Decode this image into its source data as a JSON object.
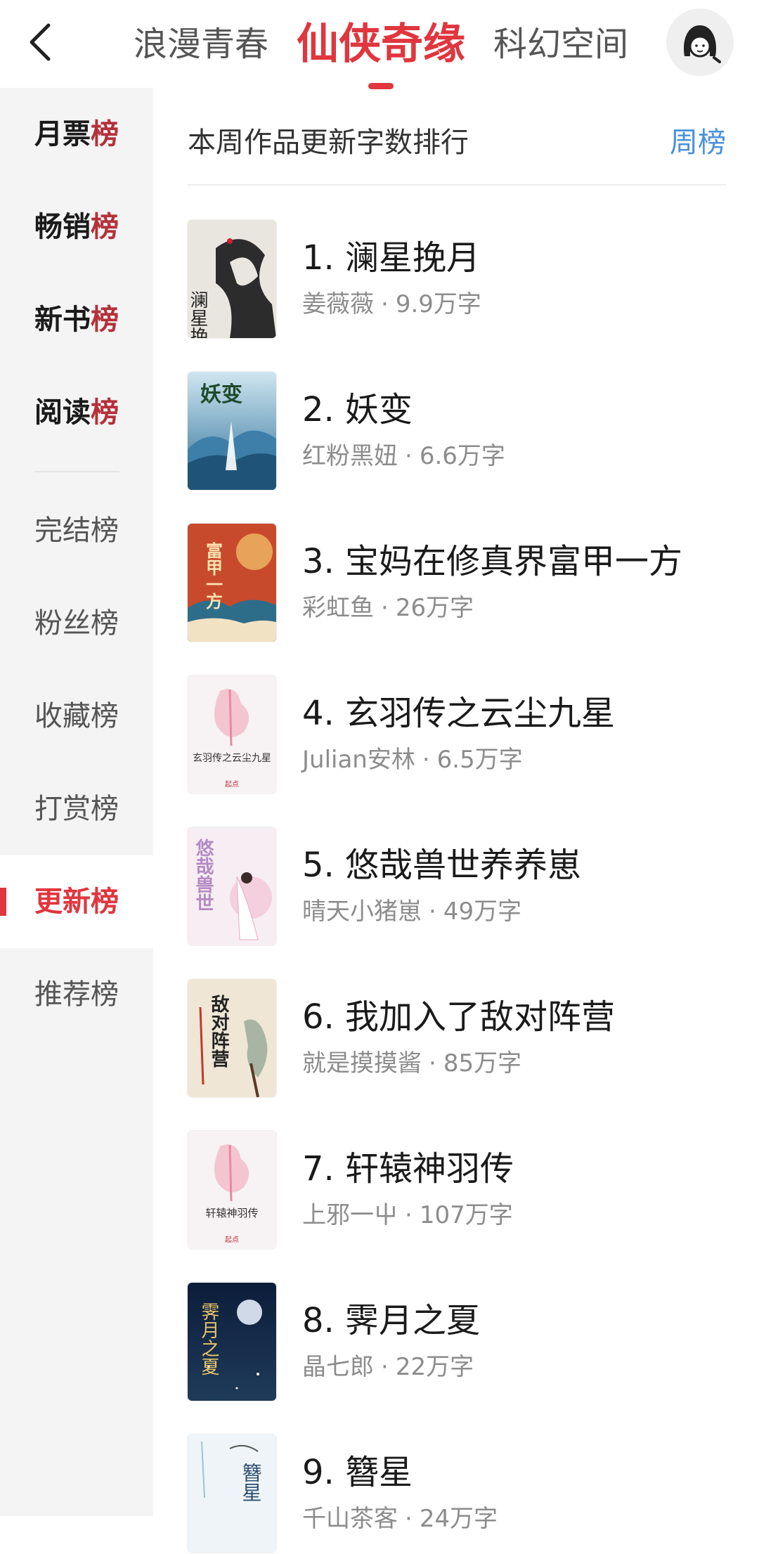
{
  "header": {
    "tabs": [
      {
        "label": "浪漫青春"
      },
      {
        "label": "仙侠奇缘"
      },
      {
        "label": "科幻空间"
      }
    ],
    "active_tab": "仙侠奇缘"
  },
  "sidebar": {
    "items": [
      {
        "prefix": "月票",
        "suffix": "榜"
      },
      {
        "prefix": "畅销",
        "suffix": "榜"
      },
      {
        "prefix": "新书",
        "suffix": "榜"
      },
      {
        "prefix": "阅读",
        "suffix": "榜"
      },
      {
        "label": "完结榜"
      },
      {
        "label": "粉丝榜"
      },
      {
        "label": "收藏榜"
      },
      {
        "label": "打赏榜"
      },
      {
        "label": "更新榜"
      },
      {
        "label": "推荐榜"
      }
    ],
    "active": "更新榜"
  },
  "list": {
    "title": "本周作品更新字数排行",
    "period": "周榜",
    "books": [
      {
        "title": "1. 澜星挽月",
        "author": "姜薇薇",
        "words": "9.9万字",
        "cover_text": "澜星挽月"
      },
      {
        "title": "2. 妖变",
        "author": "红粉黑妞",
        "words": "6.6万字",
        "cover_text": "妖变"
      },
      {
        "title": "3. 宝妈在修真界富甲一方",
        "author": "彩虹鱼",
        "words": "26万字",
        "cover_text": "富甲一方"
      },
      {
        "title": "4. 玄羽传之云尘九星",
        "author": "Julian安林",
        "words": "6.5万字",
        "cover_text": "玄羽传之云尘九星"
      },
      {
        "title": "5. 悠哉兽世养养崽",
        "author": "晴天小猪崽",
        "words": "49万字",
        "cover_text": "悠哉兽世"
      },
      {
        "title": "6. 我加入了敌对阵营",
        "author": "就是摸摸酱",
        "words": "85万字",
        "cover_text": "敌对阵营"
      },
      {
        "title": "7. 轩辕神羽传",
        "author": "上邪一屮",
        "words": "107万字",
        "cover_text": "轩辕神羽传"
      },
      {
        "title": "8. 霁月之夏",
        "author": "晶七郎",
        "words": "22万字",
        "cover_text": "霁月之夏"
      },
      {
        "title": "9. 簪星",
        "author": "千山茶客",
        "words": "24万字",
        "cover_text": "簪星"
      }
    ]
  },
  "colors": {
    "accent": "#e0363e",
    "link": "#4a90d9",
    "sidebar_bg": "#f4f4f4"
  },
  "icons": {
    "back": "chevron-left-icon",
    "avatar": "girl-avatar-icon"
  }
}
